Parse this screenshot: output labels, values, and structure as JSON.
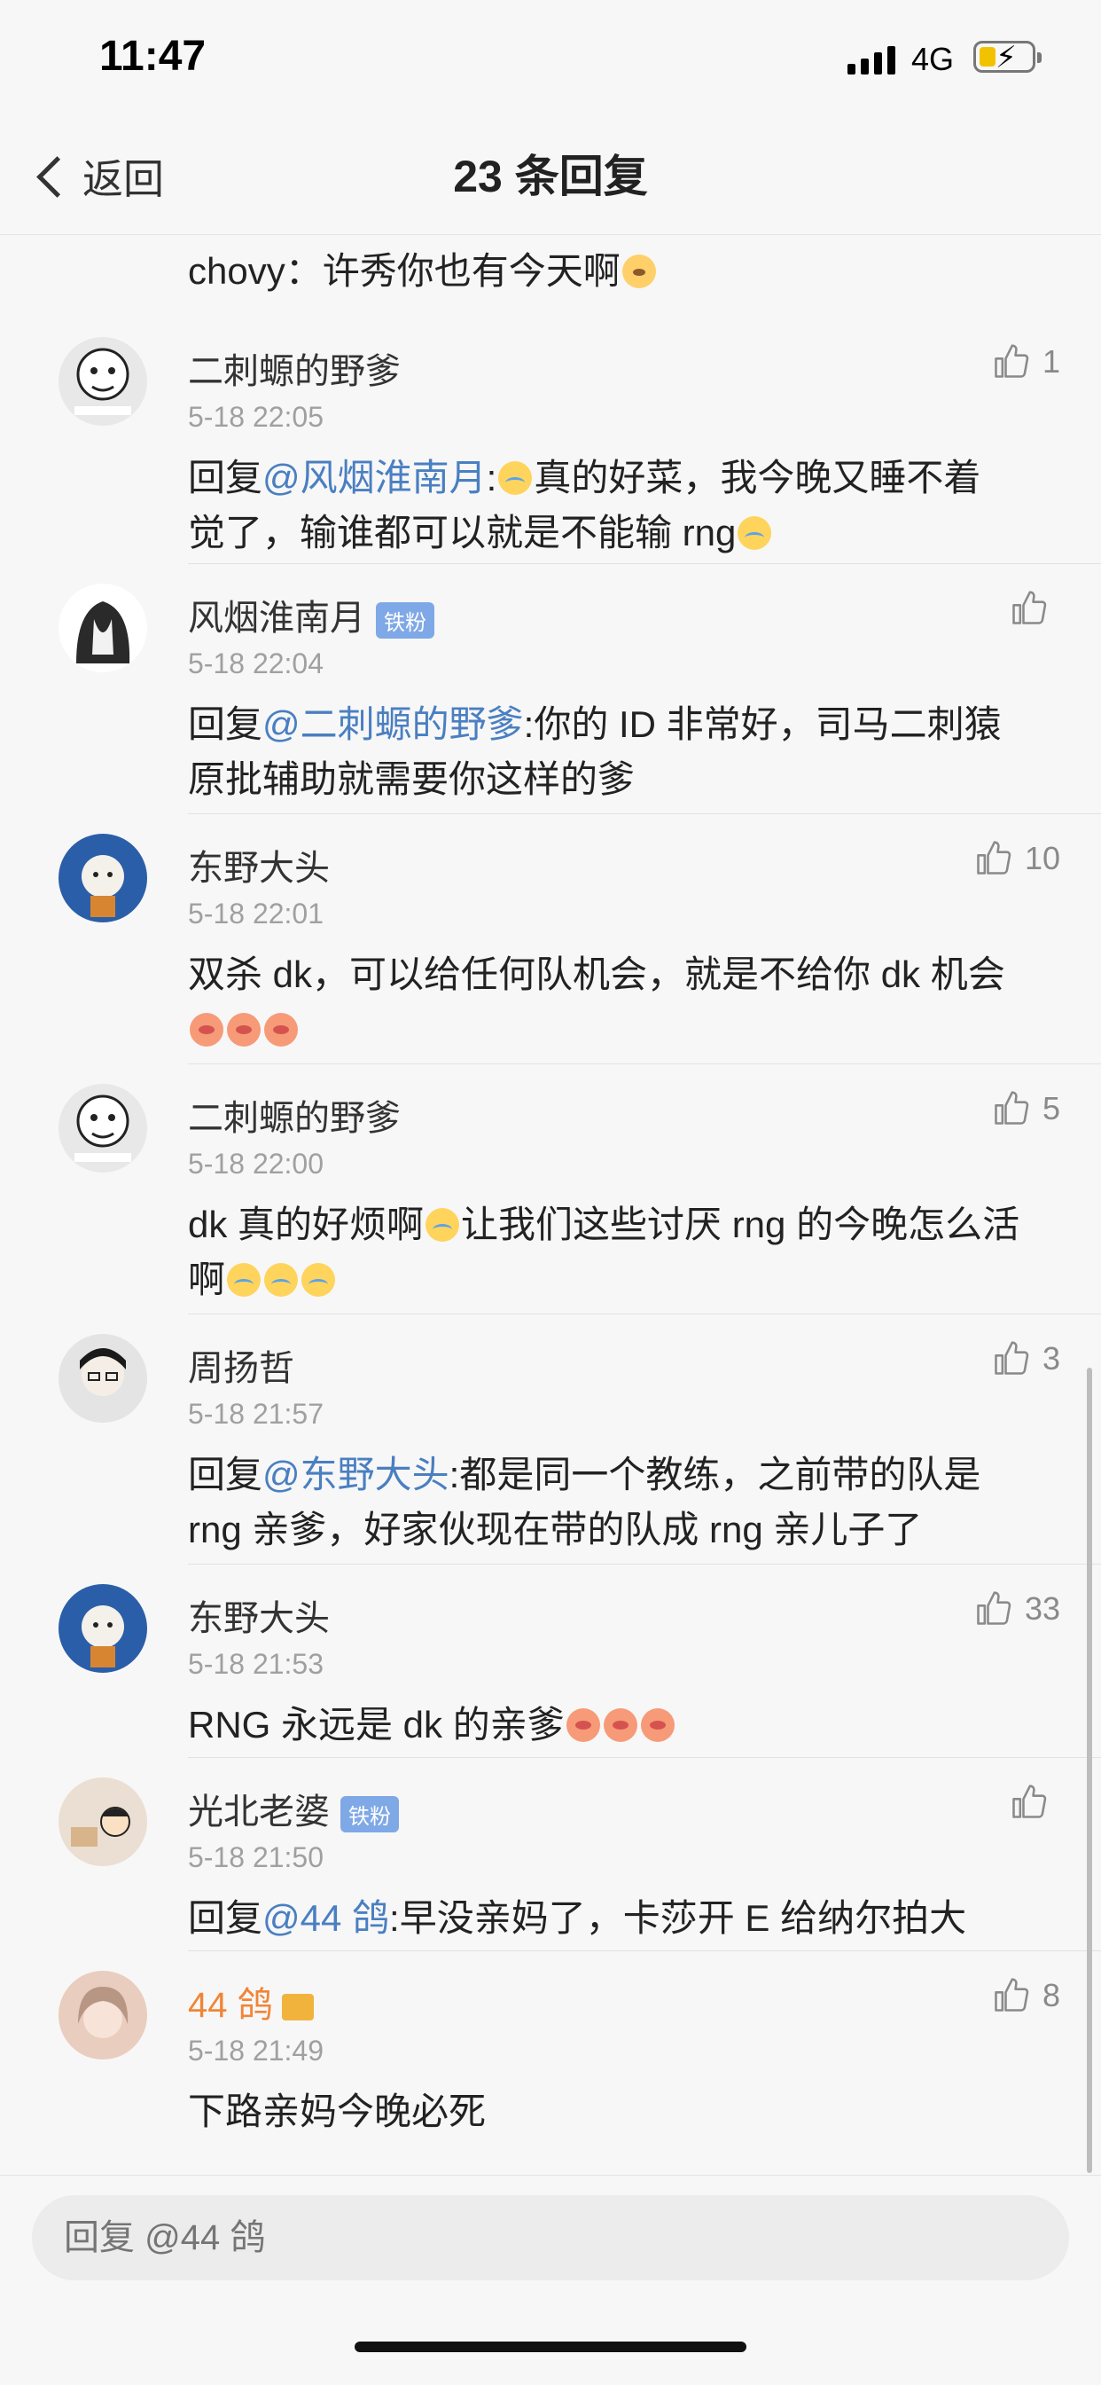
{
  "status": {
    "time": "11:47",
    "network": "4G"
  },
  "nav": {
    "back_label": "返回",
    "title": "23 条回复"
  },
  "top_snippet": {
    "prefix": "chovy：许秀你也有今天啊"
  },
  "comments": [
    {
      "name": "二刺螈的野爹",
      "time": "5-18 22:05",
      "likes": "1",
      "avatar_color": "#e8e8e8",
      "line1_prefix": "回复",
      "mention": "@风烟淮南月",
      "line1_after": ":",
      "line1_rest": "真的好菜，我今晚又睡不着",
      "line2": "觉了，输谁都可以就是不能输 rng"
    },
    {
      "name": "风烟淮南月",
      "badge": "铁粉",
      "time": "5-18 22:04",
      "likes": "",
      "avatar_color": "#3a3a3a",
      "line1_prefix": "回复",
      "mention": "@二刺螈的野爹",
      "line1_rest": ":你的 ID 非常好，司马二刺猿",
      "line2": "原批辅助就需要你这样的爹"
    },
    {
      "name": "东野大头",
      "time": "5-18 22:01",
      "likes": "10",
      "avatar_color": "#2b5ea8",
      "line1_rest": "双杀 dk，可以给任何队机会，就是不给你 dk 机会"
    },
    {
      "name": "二刺螈的野爹",
      "time": "5-18 22:00",
      "likes": "5",
      "avatar_color": "#e8e8e8",
      "line1_rest": "dk 真的好烦啊",
      "line1_rest2": "让我们这些讨厌 rng 的今晚怎么活",
      "line2": "啊"
    },
    {
      "name": "周扬哲",
      "time": "5-18 21:57",
      "likes": "3",
      "avatar_color": "#d0d0d0",
      "line1_prefix": "回复",
      "mention": "@东野大头",
      "line1_rest": ":都是同一个教练，之前带的队是",
      "line2": "rng 亲爹，好家伙现在带的队成 rng 亲儿子了"
    },
    {
      "name": "东野大头",
      "time": "5-18 21:53",
      "likes": "33",
      "avatar_color": "#2b5ea8",
      "line1_rest": "RNG 永远是 dk 的亲爹"
    },
    {
      "name": "光北老婆",
      "badge": "铁粉",
      "time": "5-18 21:50",
      "likes": "",
      "avatar_color": "#eadfd2",
      "line1_prefix": "回复",
      "mention": "@44 鸽",
      "line1_rest": ":早没亲妈了，卡莎开 E 给纳尔拍大"
    },
    {
      "name": "44 鸽",
      "time": "5-18 21:49",
      "likes": "8",
      "avatar_color": "#e9cdbf",
      "line1_rest": "下路亲妈今晚必死"
    }
  ],
  "reply": {
    "placeholder": "回复 @44 鸽"
  },
  "colors": {
    "mention": "#4a7fc1",
    "vip_name": "#f08537",
    "badge": "#7fa8e6"
  }
}
